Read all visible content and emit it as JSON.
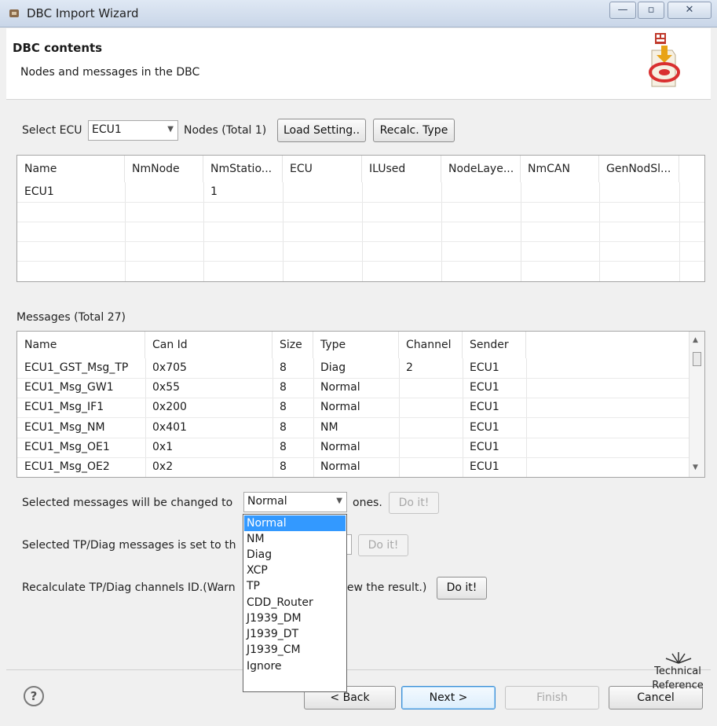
{
  "window": {
    "title": "DBC Import Wizard",
    "minimize": "—",
    "maximize": "▫",
    "close": "✕"
  },
  "header": {
    "title": "DBC contents",
    "subtitle": "Nodes and messages in the DBC"
  },
  "ecu": {
    "select_label": "Select ECU",
    "selected": "ECU1",
    "nodes_label": "Nodes (Total 1)",
    "load_button": "Load Setting..",
    "recalc_button": "Recalc. Type"
  },
  "nodes_table": {
    "columns": [
      "Name",
      "NmNode",
      "NmStatio...",
      "ECU",
      "ILUsed",
      "NodeLaye...",
      "NmCAN",
      "GenNodSl..."
    ],
    "rows": [
      [
        "ECU1",
        "",
        "1",
        "",
        "",
        "",
        "",
        ""
      ]
    ]
  },
  "messages": {
    "label": "Messages (Total 27)",
    "columns": [
      "Name",
      "Can Id",
      "Size",
      "Type",
      "Channel",
      "Sender"
    ],
    "rows": [
      [
        "ECU1_GST_Msg_TP",
        "0x705",
        "8",
        "Diag",
        "2",
        "ECU1"
      ],
      [
        "ECU1_Msg_GW1",
        "0x55",
        "8",
        "Normal",
        "",
        "ECU1"
      ],
      [
        "ECU1_Msg_IF1",
        "0x200",
        "8",
        "Normal",
        "",
        "ECU1"
      ],
      [
        "ECU1_Msg_NM",
        "0x401",
        "8",
        "NM",
        "",
        "ECU1"
      ],
      [
        "ECU1_Msg_OE1",
        "0x1",
        "8",
        "Normal",
        "",
        "ECU1"
      ],
      [
        "ECU1_Msg_OE2",
        "0x2",
        "8",
        "Normal",
        "",
        "ECU1"
      ]
    ]
  },
  "change_type": {
    "label": "Selected messages will be changed to",
    "selected": "Normal",
    "suffix": "ones.",
    "button": "Do it!"
  },
  "tp_diag": {
    "label_visible": "Selected TP/Diag messages is set to th",
    "button": "Do it!"
  },
  "recalc_channels": {
    "label_left": "Recalculate TP/Diag channels ID.(Warn",
    "label_right": "iew the result.)",
    "button": "Do it!"
  },
  "type_dropdown": {
    "options": [
      "Normal",
      "NM",
      "Diag",
      "XCP",
      "TP",
      "CDD_Router",
      "J1939_DM",
      "J1939_DT",
      "J1939_CM",
      "Ignore"
    ],
    "highlighted": "Normal"
  },
  "footer": {
    "help": "?",
    "back": "< Back",
    "next": "Next >",
    "finish": "Finish",
    "cancel": "Cancel"
  },
  "watermark": {
    "line1": "Technical",
    "line2": "Reference"
  }
}
